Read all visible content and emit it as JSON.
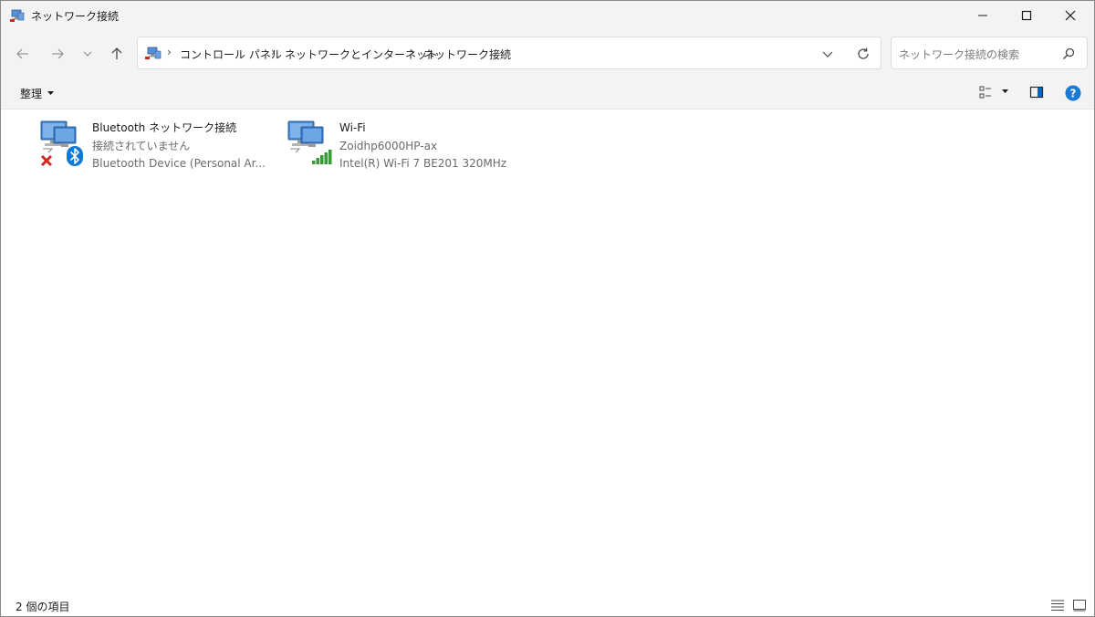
{
  "window": {
    "title": "ネットワーク接続",
    "controls": {
      "minimize": "minimize",
      "maximize": "maximize",
      "close": "close"
    }
  },
  "navigation": {
    "back_icon": "arrow-left-icon",
    "forward_icon": "arrow-right-icon",
    "recent_icon": "chevron-down-icon",
    "up_icon": "arrow-up-icon"
  },
  "address": {
    "breadcrumbs": [
      "コントロール パネル",
      "ネットワークとインターネット",
      "ネットワーク接続"
    ],
    "separator": "›"
  },
  "search": {
    "placeholder": "ネットワーク接続の検索"
  },
  "toolbar": {
    "organize_label": "整理"
  },
  "items": [
    {
      "name": "Bluetooth ネットワーク接続",
      "status": "接続されていません",
      "device": "Bluetooth Device (Personal Ar...",
      "icon": "bluetooth-network-disconnected-icon"
    },
    {
      "name": "Wi-Fi",
      "status": "Zoidhp6000HP-ax",
      "device": "Intel(R) Wi-Fi 7 BE201 320MHz",
      "icon": "wifi-network-icon"
    }
  ],
  "statusbar": {
    "count_text": "2 個の項目"
  },
  "colors": {
    "chrome": "#f3f3f3",
    "accent": "#0067c0",
    "error": "#d4261c",
    "signal": "#3a9a3a"
  }
}
